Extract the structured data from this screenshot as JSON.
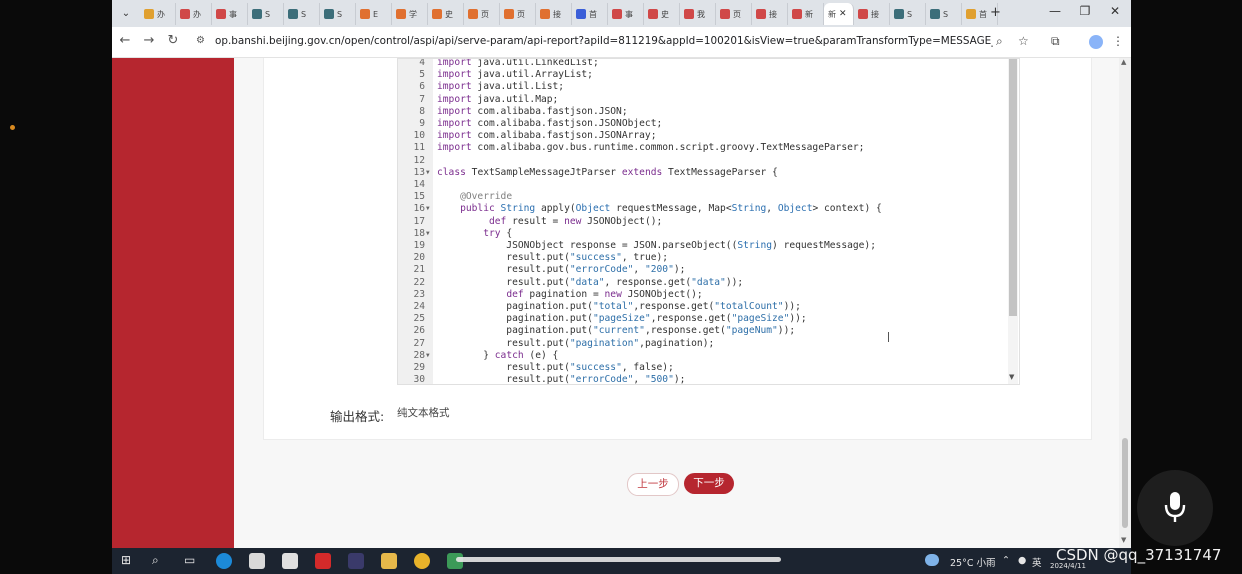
{
  "browser": {
    "tabs": [
      {
        "label": "办",
        "color": "#e0a030"
      },
      {
        "label": "办",
        "color": "#d04848"
      },
      {
        "label": "事",
        "color": "#d04848"
      },
      {
        "label": "S",
        "color": "#3c6e7a"
      },
      {
        "label": "S",
        "color": "#3c6e7a"
      },
      {
        "label": "S",
        "color": "#3c6e7a"
      },
      {
        "label": "E",
        "color": "#e07030"
      },
      {
        "label": "学",
        "color": "#e07030"
      },
      {
        "label": "史",
        "color": "#e07030"
      },
      {
        "label": "页",
        "color": "#e07030"
      },
      {
        "label": "页",
        "color": "#e07030"
      },
      {
        "label": "接",
        "color": "#e07030"
      },
      {
        "label": "首",
        "color": "#3a5ed8"
      },
      {
        "label": "事",
        "color": "#d04848"
      },
      {
        "label": "史",
        "color": "#d04848"
      },
      {
        "label": "我",
        "color": "#d04848"
      },
      {
        "label": "页",
        "color": "#d04848"
      },
      {
        "label": "接",
        "color": "#d04848"
      },
      {
        "label": "新",
        "color": "#d04848"
      },
      {
        "label": "接",
        "color": "#d04848"
      },
      {
        "label": "S",
        "color": "#3c6e7a"
      },
      {
        "label": "S",
        "color": "#3c6e7a"
      },
      {
        "label": "首",
        "color": "#e0a030"
      }
    ],
    "active_tab": {
      "label": "新",
      "close": "✕"
    },
    "url": "op.banshi.beijing.gov.cn/open/control/aspi/api/serve-param/api-report?apiId=811219&appId=100201&isView=true&paramTransformType=MESSAGE_MAPPING&serviceId..."
  },
  "editor": {
    "lines": [
      {
        "n": "4",
        "fold": false,
        "html": "<span class=\"kw\">import</span> java.util.LinkedList;"
      },
      {
        "n": "5",
        "fold": false,
        "html": "<span class=\"kw\">import</span> java.util.ArrayList;"
      },
      {
        "n": "6",
        "fold": false,
        "html": "<span class=\"kw\">import</span> java.util.List;"
      },
      {
        "n": "7",
        "fold": false,
        "html": "<span class=\"kw\">import</span> java.util.Map;"
      },
      {
        "n": "8",
        "fold": false,
        "html": "<span class=\"kw\">import</span> com.alibaba.fastjson.JSON;"
      },
      {
        "n": "9",
        "fold": false,
        "html": "<span class=\"kw\">import</span> com.alibaba.fastjson.JSONObject;"
      },
      {
        "n": "10",
        "fold": false,
        "html": "<span class=\"kw\">import</span> com.alibaba.fastjson.JSONArray;"
      },
      {
        "n": "11",
        "fold": false,
        "html": "<span class=\"kw\">import</span> com.alibaba.gov.bus.runtime.common.script.groovy.TextMessageParser;"
      },
      {
        "n": "12",
        "fold": false,
        "html": ""
      },
      {
        "n": "13",
        "fold": true,
        "html": "<span class=\"kw\">class</span> TextSampleMessageJtParser <span class=\"kw\">extends</span> TextMessageParser {"
      },
      {
        "n": "14",
        "fold": false,
        "html": ""
      },
      {
        "n": "15",
        "fold": false,
        "html": "    <span class=\"an\">@Override</span>"
      },
      {
        "n": "16",
        "fold": true,
        "html": "    <span class=\"kw\">public</span> <span class=\"ty\">String</span> apply(<span class=\"ty\">Object</span> requestMessage, Map&lt;<span class=\"ty\">String</span>, <span class=\"ty\">Object</span>&gt; context) {"
      },
      {
        "n": "17",
        "fold": false,
        "html": "         <span class=\"kw\">def</span> result = <span class=\"kw\">new</span> JSONObject();"
      },
      {
        "n": "18",
        "fold": true,
        "html": "        <span class=\"kw\">try</span> {"
      },
      {
        "n": "19",
        "fold": false,
        "html": "            JSONObject response = JSON.parseObject((<span class=\"ty\">String</span>) requestMessage);"
      },
      {
        "n": "20",
        "fold": false,
        "html": "            result.put(<span class=\"st\">\"success\"</span>, true);"
      },
      {
        "n": "21",
        "fold": false,
        "html": "            result.put(<span class=\"st\">\"errorCode\"</span>, <span class=\"st\">\"200\"</span>);"
      },
      {
        "n": "22",
        "fold": false,
        "html": "            result.put(<span class=\"st\">\"data\"</span>, response.get(<span class=\"st\">\"data\"</span>));"
      },
      {
        "n": "23",
        "fold": false,
        "html": "            <span class=\"kw\">def</span> pagination = <span class=\"kw\">new</span> JSONObject();"
      },
      {
        "n": "24",
        "fold": false,
        "html": "            pagination.put(<span class=\"st\">\"total\"</span>,response.get(<span class=\"st\">\"totalCount\"</span>));"
      },
      {
        "n": "25",
        "fold": false,
        "html": "            pagination.put(<span class=\"st\">\"pageSize\"</span>,response.get(<span class=\"st\">\"pageSize\"</span>));"
      },
      {
        "n": "26",
        "fold": false,
        "html": "            pagination.put(<span class=\"st\">\"current\"</span>,response.get(<span class=\"st\">\"pageNum\"</span>));"
      },
      {
        "n": "27",
        "fold": false,
        "html": "            result.put(<span class=\"st\">\"pagination\"</span>,pagination);"
      },
      {
        "n": "28",
        "fold": true,
        "html": "        } <span class=\"kw\">catch</span> (e) {"
      },
      {
        "n": "29",
        "fold": false,
        "html": "            result.put(<span class=\"st\">\"success\"</span>, false);"
      },
      {
        "n": "30",
        "fold": false,
        "html": "            result.put(<span class=\"st\">\"errorCode\"</span>, <span class=\"st\">\"500\"</span>);"
      }
    ]
  },
  "form": {
    "output_label": "输出格式:",
    "output_value": "纯文本格式",
    "prev_button": "上一步",
    "next_button": "下一步"
  },
  "taskbar": {
    "weather": "25°C 小雨",
    "ime": "英",
    "date": "2024/4/11"
  },
  "watermark": "CSDN @qq_37131747",
  "colors": {
    "brand_red": "#b6262f",
    "taskbar": "#1c2430"
  }
}
